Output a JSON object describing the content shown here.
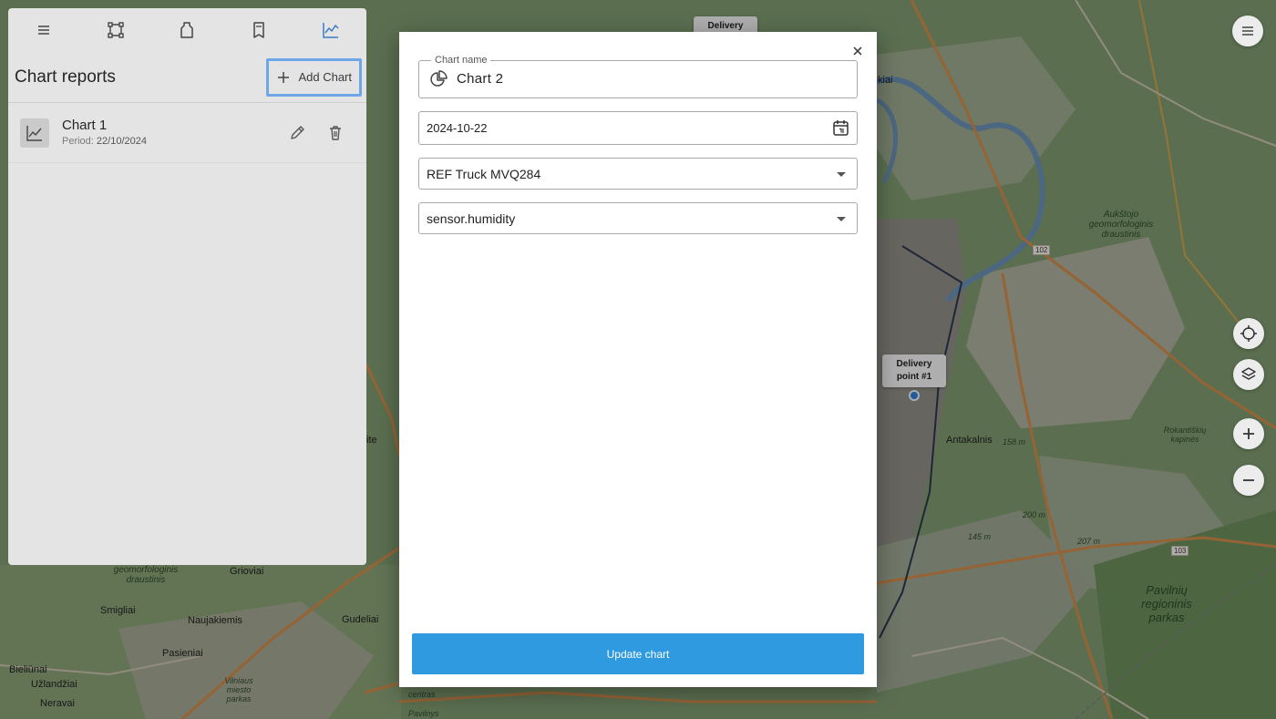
{
  "map": {
    "labels": {
      "aukstoji": "Aukštojo\ngeomorfologinis\ndraustinis",
      "antakalnis": "Antakalnis",
      "pavilniu": "Pavilnių\nregioninis\nparkas",
      "naujakiemis": "Naujakiemis",
      "smigliai": "Smigliai",
      "pasieniai": "Pasieniai",
      "gudeliai": "Gudeliai",
      "grioviai": "Grioviai",
      "bieliunai": "Bieliūnai",
      "uzlandziai": "Užlandžiai",
      "neravai": "Neravai",
      "geomorf": "geomorfologinis\ndraustinis",
      "rokantiskiu": "Rokantiškių\nkapinės",
      "ite": "ite",
      "kiai": "kiai",
      "vilniaus": "Vilniaus\nmiesto\nparkas",
      "centras": "centras",
      "pavilnys": "Pavilnys"
    },
    "road_badges": {
      "r102": "102",
      "r103": "103"
    },
    "elevations": {
      "e158": "158 m",
      "e200": "200 m",
      "e207": "207 m",
      "e145": "145 m"
    },
    "pins": {
      "top": "Delivery",
      "point1_line1": "Delivery",
      "point1_line2": "point #1"
    }
  },
  "map_controls": [
    "locate-icon",
    "layers-icon",
    "zoom-in-icon",
    "zoom-out-icon",
    "menu-icon"
  ],
  "left_panel": {
    "toolbar": [
      "menu-icon",
      "route-icon",
      "geofence-icon",
      "bookmark-icon",
      "chart-icon"
    ],
    "title": "Chart reports",
    "add_button": "Add Chart",
    "items": [
      {
        "name": "Chart 1",
        "period_label": "Period:",
        "period_value": "22/10/2024"
      }
    ]
  },
  "dialog": {
    "name_legend": "Chart name",
    "name_value": "Chart 2",
    "date_value": "2024-10-22",
    "vehicle_value": "REF Truck MVQ284",
    "sensor_value": "sensor.humidity",
    "update_button": "Update chart"
  },
  "colors": {
    "accent": "#2f9ae0",
    "focus_outline": "#6ea6e8",
    "map_point": "#2f7fd6"
  }
}
